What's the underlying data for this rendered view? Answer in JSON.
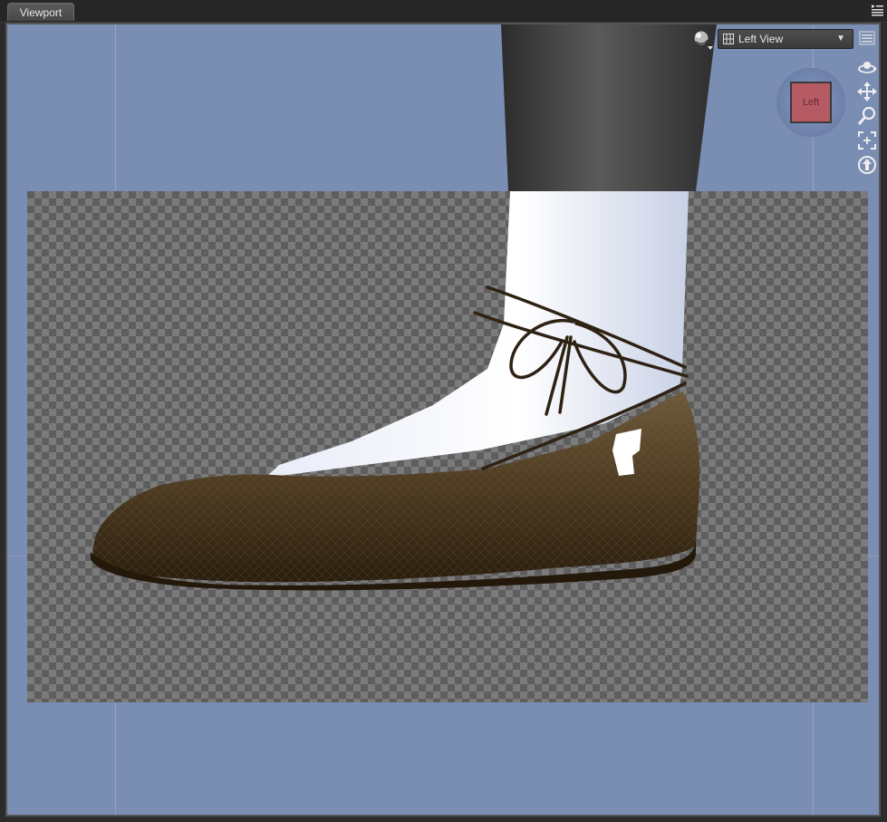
{
  "panel": {
    "tab_label": "Viewport"
  },
  "viewport": {
    "view_label": "Left View",
    "cube_face_label": "Left",
    "background_color": "#7a8db3",
    "checker_light": "#7b7b7b",
    "checker_dark": "#5e5e5e",
    "cube_face_color": "#b65a64"
  },
  "icons": {
    "pane_menu": "pane-menu-icon",
    "draw_style": "draw-style-sphere-icon",
    "view_type": "view-grid-icon",
    "side_menu": "viewport-options-icon",
    "nav": [
      "orbit-icon",
      "pan-icon",
      "zoom-icon",
      "frame-icon",
      "aim-icon"
    ]
  }
}
